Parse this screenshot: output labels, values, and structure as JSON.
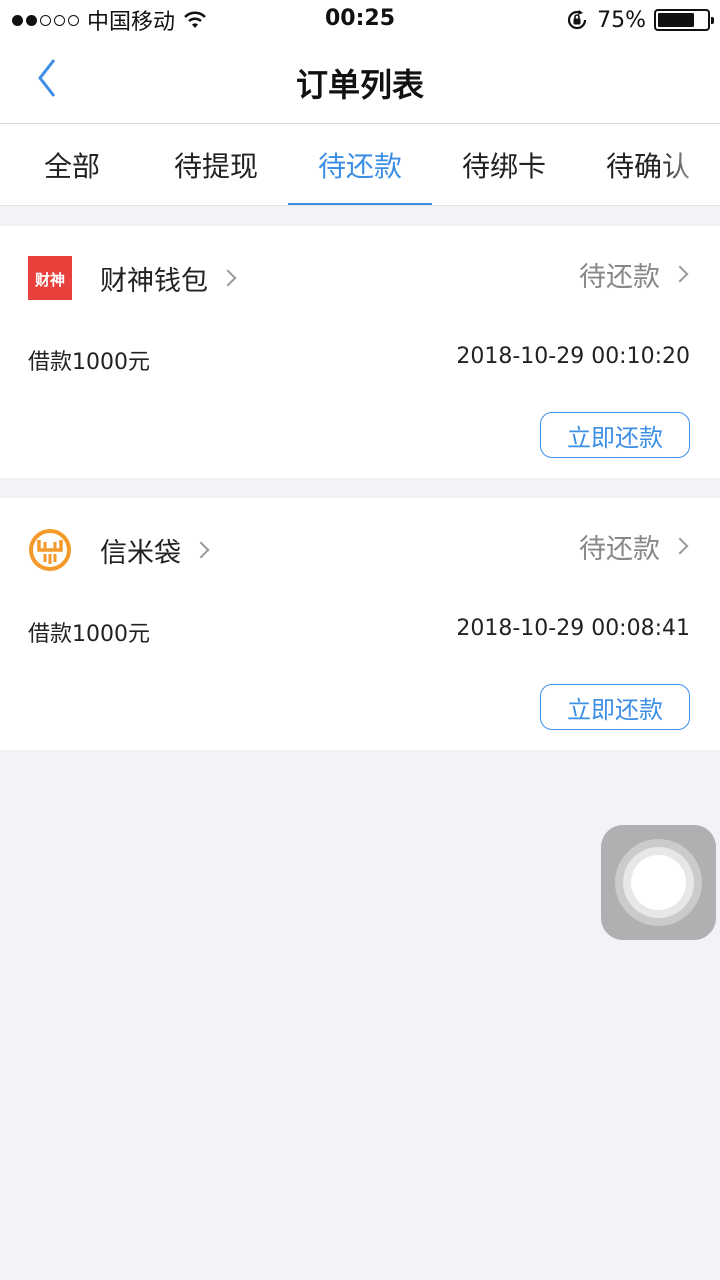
{
  "status_bar": {
    "carrier": "中国移动",
    "time": "00:25",
    "battery": "75%",
    "battery_level": 0.75
  },
  "nav": {
    "title": "订单列表",
    "back_icon": "chevron-left-icon"
  },
  "tabs": [
    {
      "label": "全部",
      "active": false
    },
    {
      "label": "待提现",
      "active": false
    },
    {
      "label": "待还款",
      "active": true
    },
    {
      "label": "待绑卡",
      "active": false
    },
    {
      "label": "待确认",
      "active": false
    }
  ],
  "orders": [
    {
      "logo_text": "财神",
      "name": "财神钱包",
      "status": "待还款",
      "amount": "借款1000元",
      "time": "2018-10-29 00:10:20",
      "button": "立即还款"
    },
    {
      "name": "信米袋",
      "status": "待还款",
      "amount": "借款1000元",
      "time": "2018-10-29 00:08:41",
      "button": "立即还款"
    }
  ],
  "colors": {
    "accent": "#3d8fe6",
    "background": "#f2f3f6",
    "caishen_red": "#e8413b",
    "xinmi_orange": "#f39a2b"
  }
}
